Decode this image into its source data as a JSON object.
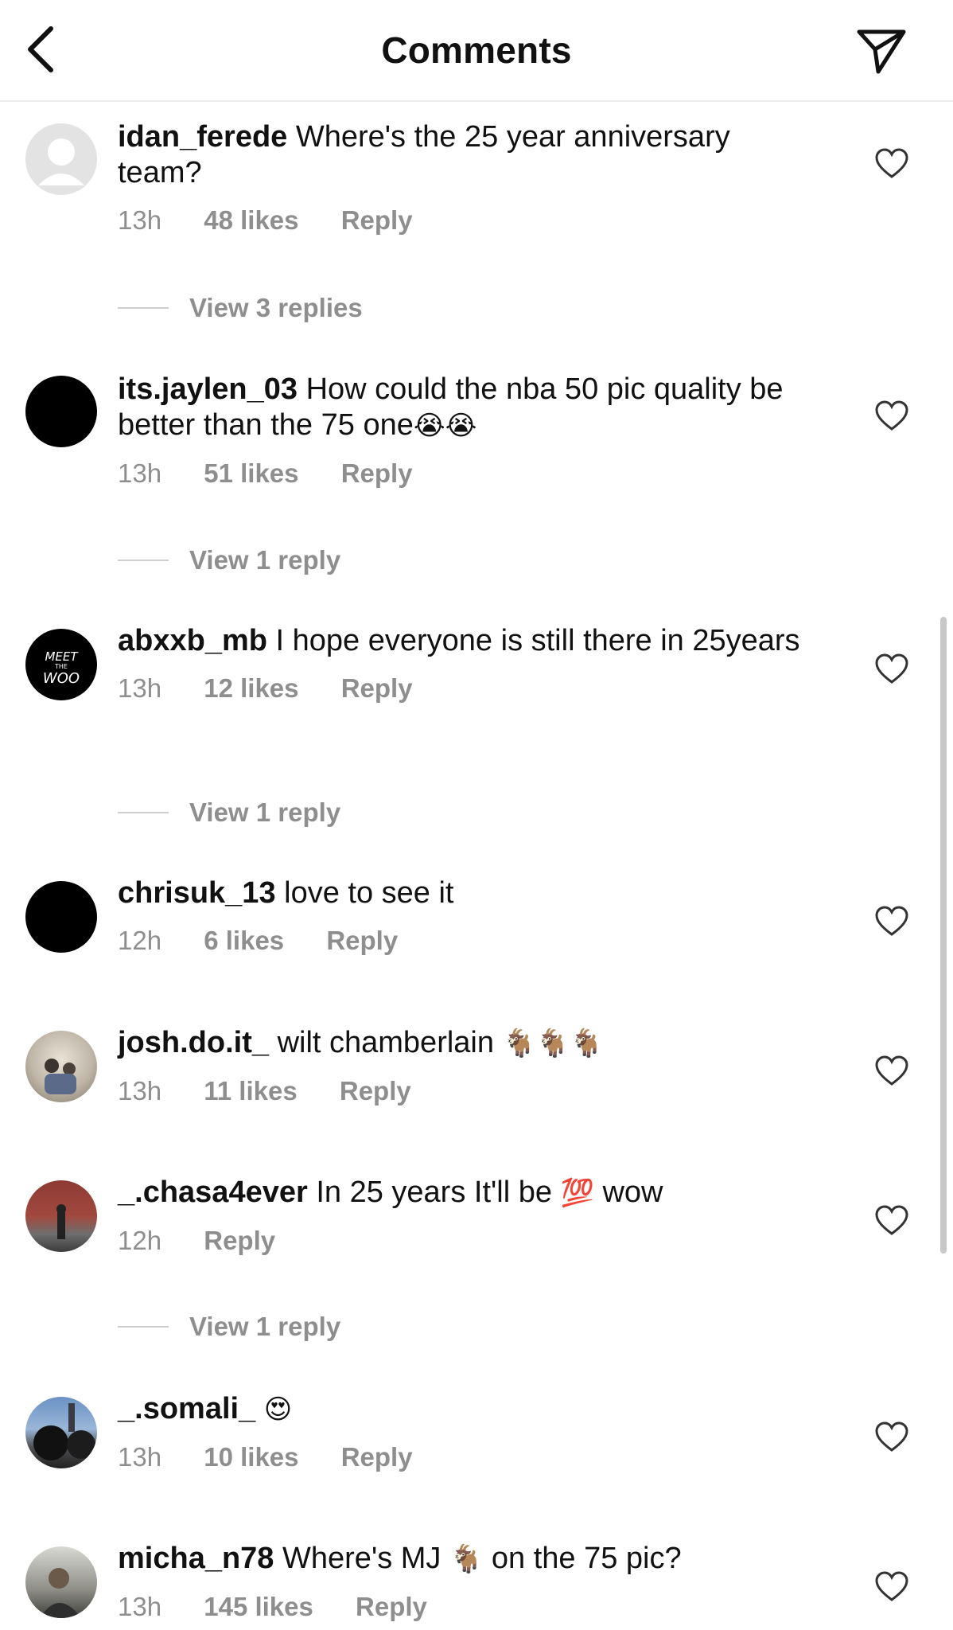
{
  "header": {
    "title": "Comments"
  },
  "comments": [
    {
      "username": "idan_ferede",
      "text": "Where's the 25 year anniversary team?",
      "time": "13h",
      "likes": "48 likes",
      "reply": "Reply",
      "view_replies": "View 3 replies"
    },
    {
      "username": "its.jaylen_03",
      "text": "How could the nba 50 pic quality be better than the 75 one",
      "emoji": "😭😭",
      "time": "13h",
      "likes": "51 likes",
      "reply": "Reply",
      "view_replies": "View 1 reply"
    },
    {
      "username": "abxxb_mb",
      "text": "I hope everyone is still there in 25years",
      "time": "13h",
      "likes": "12 likes",
      "reply": "Reply",
      "view_replies": "View 1 reply",
      "avatar_text": [
        "MEET",
        "THE",
        "WOO"
      ]
    },
    {
      "username": "chrisuk_13",
      "text": "love to see it",
      "time": "12h",
      "likes": "6 likes",
      "reply": "Reply"
    },
    {
      "username": "josh.do.it_",
      "text": "wilt chamberlain",
      "emoji": "🐐🐐🐐",
      "time": "13h",
      "likes": "11 likes",
      "reply": "Reply"
    },
    {
      "username": "_.chasa4ever",
      "text": "In 25 years It'll be",
      "emoji": "💯",
      "text_after": "wow",
      "time": "12h",
      "reply": "Reply",
      "view_replies": "View 1 reply"
    },
    {
      "username": "_.somali_",
      "emoji": "😍",
      "time": "13h",
      "likes": "10 likes",
      "reply": "Reply"
    },
    {
      "username": "micha_n78",
      "text": "Where's MJ",
      "emoji": "🐐",
      "text_after": "on the 75 pic?",
      "time": "13h",
      "likes": "145 likes",
      "reply": "Reply"
    }
  ]
}
